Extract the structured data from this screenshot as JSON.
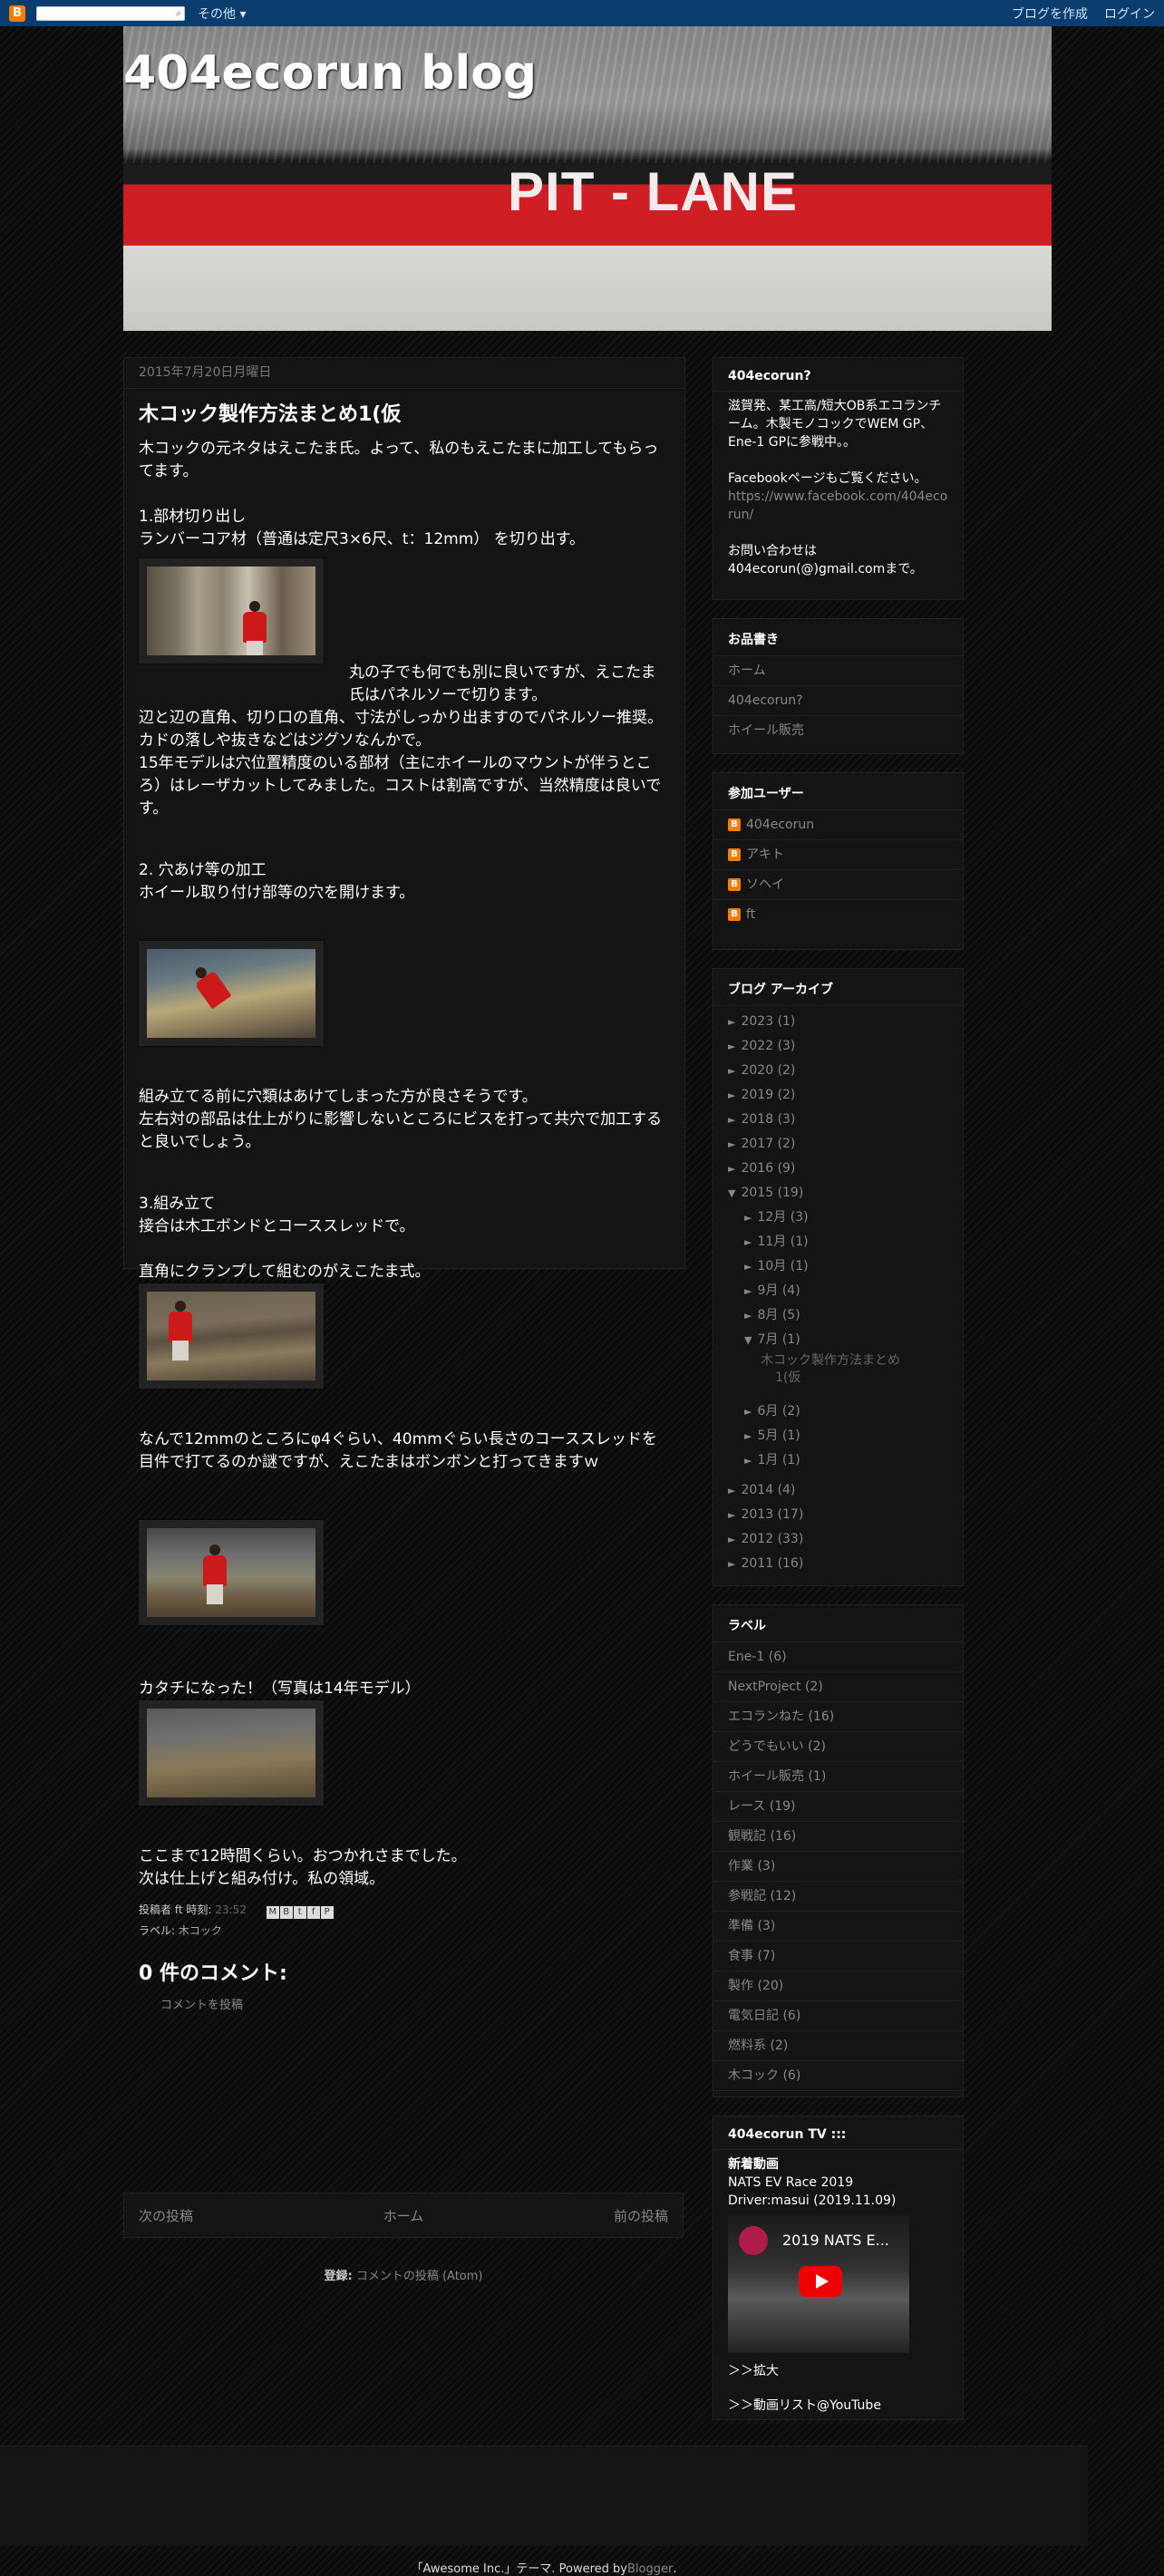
{
  "navbar": {
    "logo": "B",
    "more": "その他 ▾",
    "create_blog": "ブログを作成",
    "login": "ログイン"
  },
  "header": {
    "title": "404ecorun blog",
    "banner_text": "PIT - LANE"
  },
  "post": {
    "date": "2015年7月20日月曜日",
    "title": "木コック製作方法まとめ1(仮",
    "intro": "木コックの元ネタはえこたま氏。よって、私のもえこたまに加工してもらってます。",
    "s1_head": "1.部材切り出し",
    "s1_line": "ランバーコア材（普通は定尺3×6尺、t：12mm） を切り出す。",
    "s1_float": "丸の子でも何でも別に良いですが、えこたま氏はパネルソーで切ります。",
    "s1_p2": "辺と辺の直角、切り口の直角、寸法がしっかり出ますのでパネルソー推奨。",
    "s1_p3": "カドの落しや抜きなどはジグソなんかで。",
    "s1_p4": "15年モデルは穴位置精度のいる部材（主にホイールのマウントが伴うところ）はレーザカットしてみました。コストは割高ですが、当然精度は良いです。",
    "s2_head": "2. 穴あけ等の加工",
    "s2_line": "ホイール取り付け部等の穴を開けます。",
    "s2_p1": "組み立てる前に穴類はあけてしまった方が良さそうです。",
    "s2_p2": "左右対の部品は仕上がりに影響しないところにビスを打って共穴で加工すると良いでしょう。",
    "s3_head": "3.組み立て",
    "s3_line": "接合は木工ボンドとコーススレッドで。",
    "s3_p1": "直角にクランプして組むのがえこたま式。",
    "s3_p2": "なんで12mmのところにφ4ぐらい、40mmぐらい長さのコーススレッドを目件で打てるのか謎ですが、えこたまはボンボンと打ってきますｗ",
    "s3_p3": "カタチになった！（写真は14年モデル）",
    "end1": "ここまで12時間くらい。おつかれさまでした。",
    "end2": "次は仕上げと組み付け。私の領域。",
    "posted_by_label": "投稿者",
    "author": "ft",
    "time_label": "時刻:",
    "time": "23:52",
    "share": [
      "M",
      "B",
      "t",
      "f",
      "P"
    ],
    "labels_label": "ラベル:",
    "label": "木コック",
    "comments_title": "0 件のコメント:",
    "comment_link": "コメントを投稿"
  },
  "pager": {
    "newer": "次の投稿",
    "home": "ホーム",
    "older": "前の投稿"
  },
  "subscribe": {
    "label": "登録:",
    "link": "コメントの投稿 (Atom)"
  },
  "sidebar": {
    "about": {
      "title": "404ecorun?",
      "text1": "滋賀発、某工高/短大OB系エコランチーム。木製モノコックでWEM GP、Ene-1 GPに参戦中。。",
      "text2": "Facebookページもご覧ください。",
      "fb_link": "https://www.facebook.com/404ecorun/",
      "text3": "お問い合わせは",
      "email": "404ecorun(@)gmail.comまで。"
    },
    "pages": {
      "title": "お品書き",
      "items": [
        "ホーム",
        "404ecorun?",
        "ホイール販売"
      ]
    },
    "users": {
      "title": "参加ユーザー",
      "items": [
        "404ecorun",
        "アキト",
        "ソヘイ",
        "ft"
      ]
    },
    "archive": {
      "title": "ブログ アーカイブ",
      "years_top": [
        {
          "tri": "►",
          "label": "2023",
          "count": "(1)"
        },
        {
          "tri": "►",
          "label": "2022",
          "count": "(3)"
        },
        {
          "tri": "►",
          "label": "2020",
          "count": "(2)"
        },
        {
          "tri": "►",
          "label": "2019",
          "count": "(2)"
        },
        {
          "tri": "►",
          "label": "2018",
          "count": "(3)"
        },
        {
          "tri": "►",
          "label": "2017",
          "count": "(2)"
        },
        {
          "tri": "►",
          "label": "2016",
          "count": "(9)"
        }
      ],
      "open_year": {
        "tri": "▼",
        "label": "2015",
        "count": "(19)"
      },
      "months_before": [
        {
          "tri": "►",
          "label": "12月",
          "count": "(3)"
        },
        {
          "tri": "►",
          "label": "11月",
          "count": "(1)"
        },
        {
          "tri": "►",
          "label": "10月",
          "count": "(1)"
        },
        {
          "tri": "►",
          "label": "9月",
          "count": "(4)"
        },
        {
          "tri": "►",
          "label": "8月",
          "count": "(5)"
        }
      ],
      "open_month": {
        "tri": "▼",
        "label": "7月",
        "count": "(1)"
      },
      "post_line1": "木コック製作方法まとめ",
      "post_line2": "1(仮",
      "months_after": [
        {
          "tri": "►",
          "label": "6月",
          "count": "(2)"
        },
        {
          "tri": "►",
          "label": "5月",
          "count": "(1)"
        },
        {
          "tri": "►",
          "label": "1月",
          "count": "(1)"
        }
      ],
      "years_bottom": [
        {
          "tri": "►",
          "label": "2014",
          "count": "(4)"
        },
        {
          "tri": "►",
          "label": "2013",
          "count": "(17)"
        },
        {
          "tri": "►",
          "label": "2012",
          "count": "(33)"
        },
        {
          "tri": "►",
          "label": "2011",
          "count": "(16)"
        }
      ]
    },
    "labels": {
      "title": "ラベル",
      "items": [
        "Ene-1 (6)",
        "NextProject (2)",
        "エコランねた (16)",
        "どうでもいい (2)",
        "ホイール販売 (1)",
        "レース (19)",
        "観戦記 (16)",
        "作業 (3)",
        "参戦記 (12)",
        "準備 (3)",
        "食事 (7)",
        "製作 (20)",
        "電気日記 (6)",
        "燃料系 (2)",
        "木コック (6)"
      ]
    },
    "tv": {
      "title": "404ecorun TV :::",
      "new_label": "新着動画",
      "video_line1": "NATS EV Race 2019",
      "video_line2": "Driver:masui (2019.11.09)",
      "video_title": "2019 NATS E...",
      "link1": "＞＞拡大",
      "link2": "＞＞動画リスト@YouTube"
    }
  },
  "footer": {
    "text": "「Awesome Inc.」テーマ. Powered by ",
    "link": "Blogger",
    "end": "."
  }
}
